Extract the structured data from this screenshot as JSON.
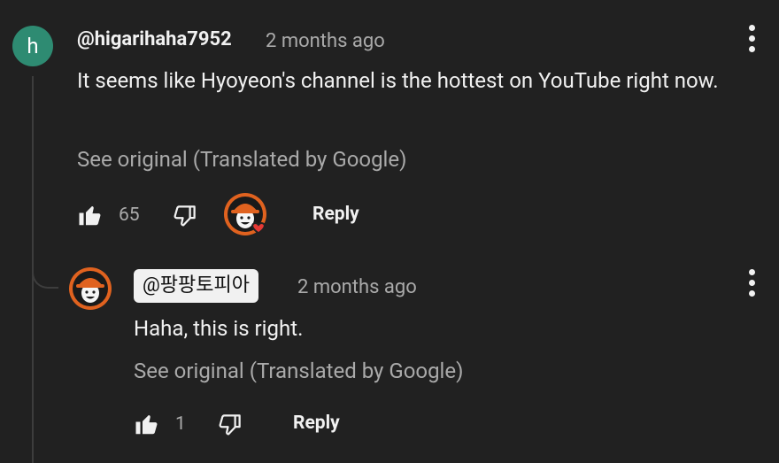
{
  "comment": {
    "avatar_letter": "h",
    "username": "@higarihaha7952",
    "timestamp": "2 months ago",
    "text": "It seems like Hyoyeon's channel is the hottest on YouTube right now.",
    "see_original": "See original (Translated by Google)",
    "like_count": "65",
    "reply_label": "Reply"
  },
  "reply": {
    "handle": "@팡팡토피아",
    "timestamp": "2 months ago",
    "text": "Haha, this is right.",
    "see_original": "See original (Translated by Google)",
    "like_count": "1",
    "reply_label": "Reply"
  },
  "colors": {
    "background": "#212121",
    "avatar_green": "#2e8b72",
    "creator_orange": "#e0621f",
    "heart_red": "#e53935"
  }
}
